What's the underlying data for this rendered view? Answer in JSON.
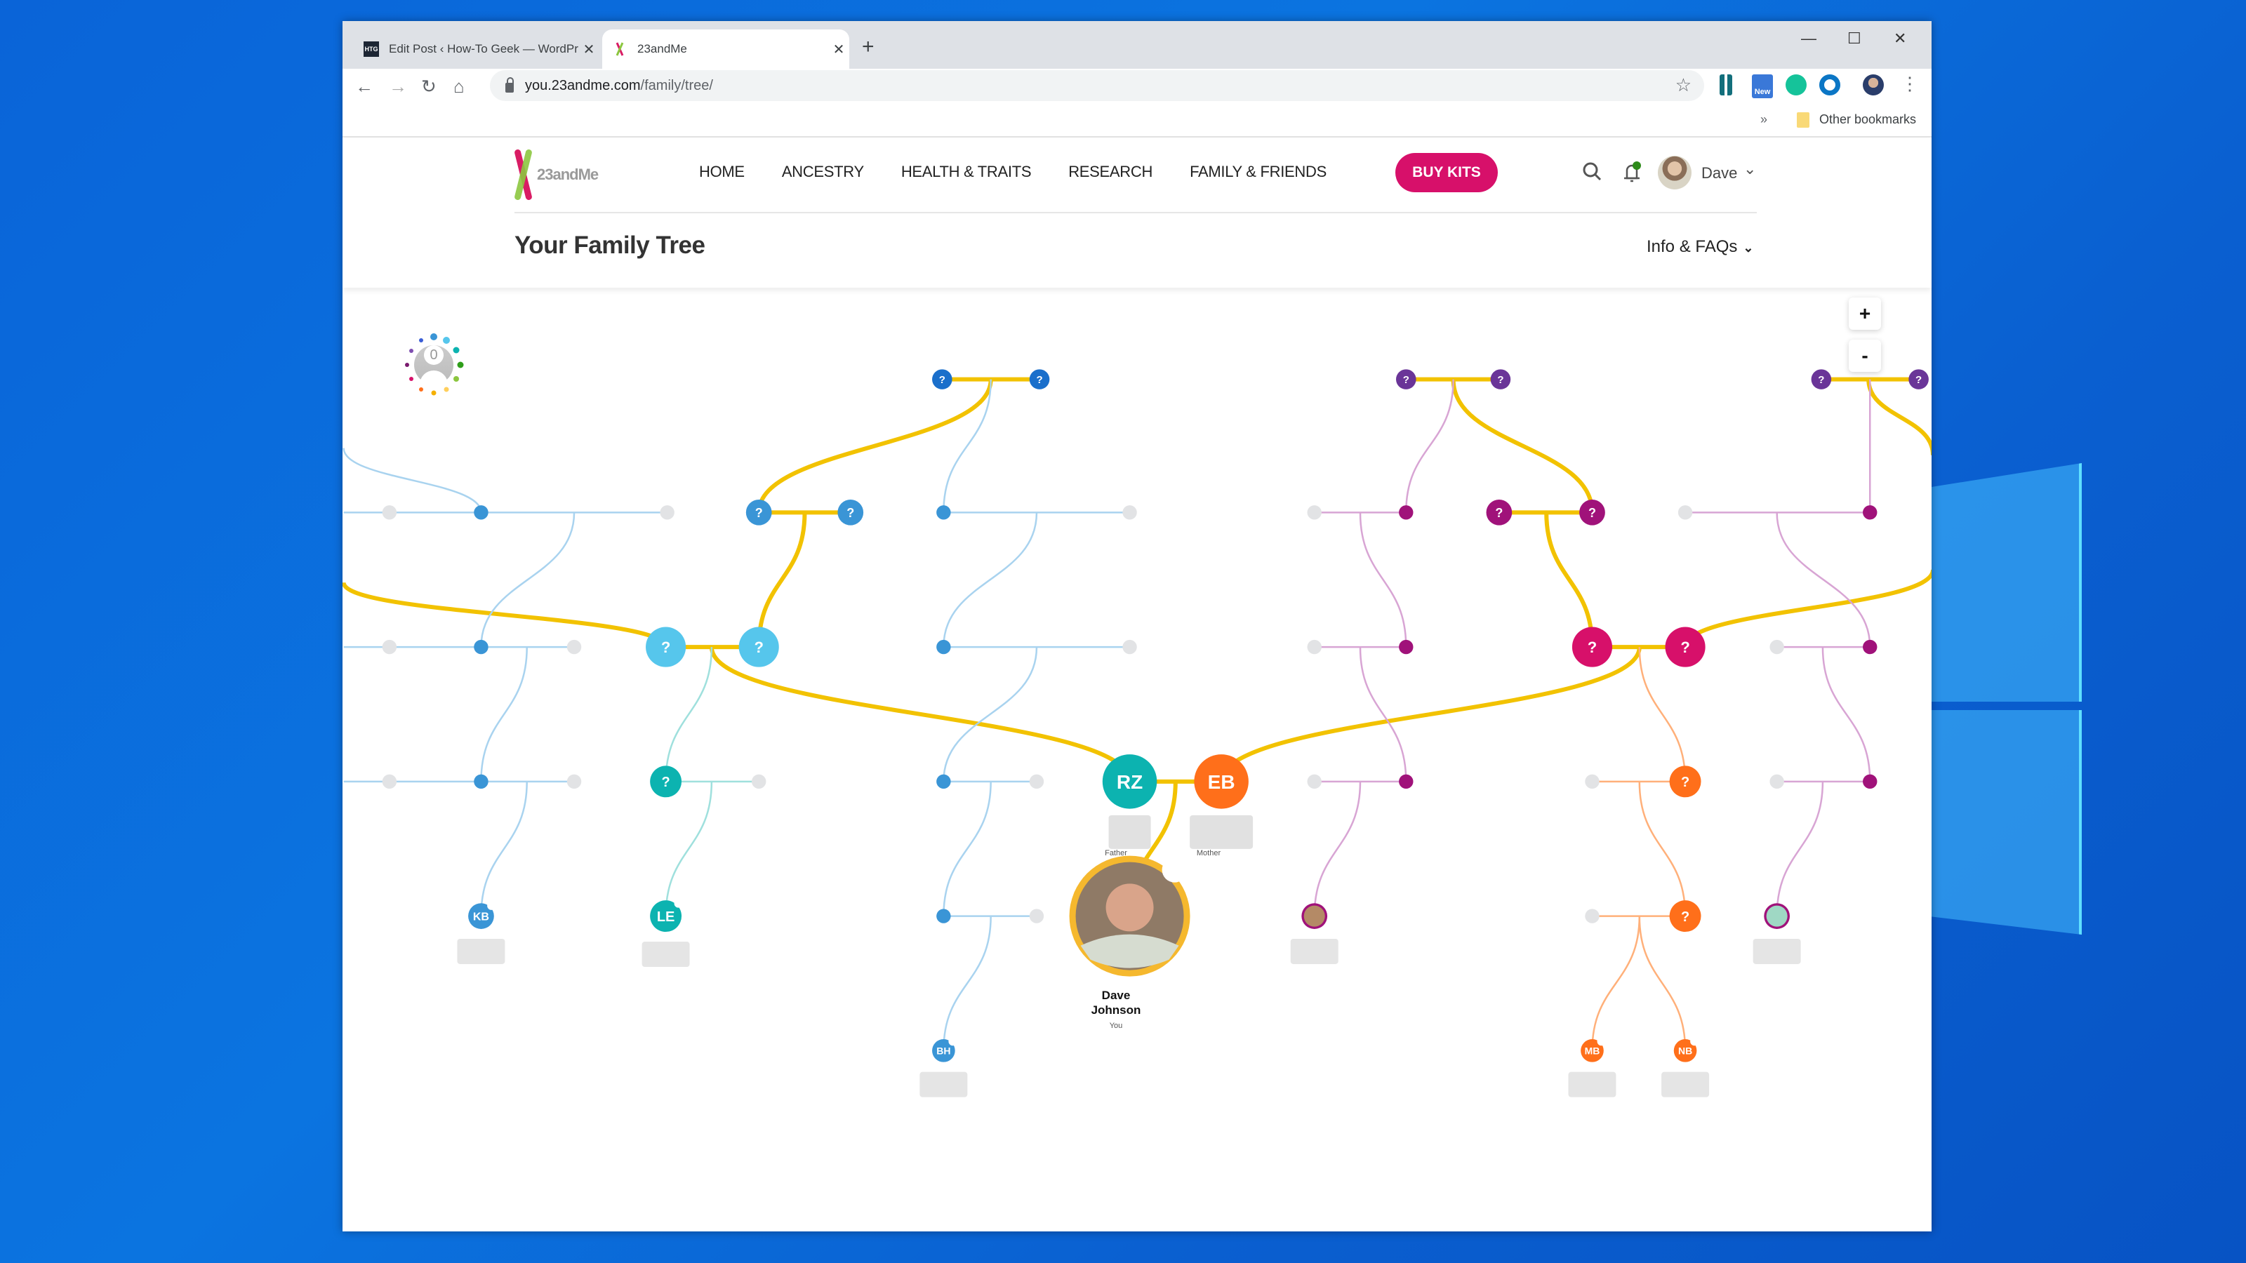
{
  "browser": {
    "tabs": [
      {
        "title": "Edit Post ‹ How-To Geek — WordPress",
        "favicon": "htg-icon",
        "active": false
      },
      {
        "title": "23andMe",
        "favicon": "23andme-icon",
        "active": true
      }
    ],
    "favicon_htg_text": "HTG",
    "new_tab": "+",
    "url_host": "you.23andme.com",
    "url_path": "/family/tree/",
    "extensions_badge": "New",
    "bookmarks_overflow": "»",
    "other_bookmarks": "Other bookmarks",
    "window_controls": {
      "minimize": "—",
      "maximize": "☐",
      "close": "✕"
    }
  },
  "site": {
    "brand": "23andMe",
    "nav": [
      "HOME",
      "ANCESTRY",
      "HEALTH & TRAITS",
      "RESEARCH",
      "FAMILY & FRIENDS"
    ],
    "buy_kits": "BUY KITS",
    "user_name": "Dave",
    "page_title": "Your Family Tree",
    "info_faqs": "Info & FAQs",
    "colors": {
      "brand_pink": "#d7106a",
      "lineage_gold": "#f2c200",
      "notification_green": "#2e8b1a"
    }
  },
  "tree": {
    "shared_dna_count": "0",
    "zoom_in": "+",
    "zoom_out": "-",
    "unknown_marker": "?",
    "you": {
      "name_line1": "Dave",
      "name_line2": "Johnson",
      "relation": "You"
    },
    "father": {
      "initials": "RZ",
      "relation": "Father"
    },
    "mother": {
      "initials": "EB",
      "relation": "Mother"
    },
    "relatives": [
      {
        "initials": "KB"
      },
      {
        "initials": "LE"
      },
      {
        "initials": "BH"
      },
      {
        "initials": "MB"
      },
      {
        "initials": "NB"
      }
    ],
    "palette": {
      "blue_dark": "#1a6fcb",
      "blue": "#3a95d6",
      "sky": "#56c6ec",
      "teal": "#0cb3b0",
      "purple": "#6a3598",
      "magenta": "#a0127a",
      "pink": "#d7106a",
      "orange": "#ff6f1a",
      "empty": "#e2e3e5",
      "line_blue": "#a9d3ef",
      "line_teal": "#9fe0dd",
      "line_purple": "#d8a5d4",
      "line_orange": "#ffb07a"
    }
  }
}
